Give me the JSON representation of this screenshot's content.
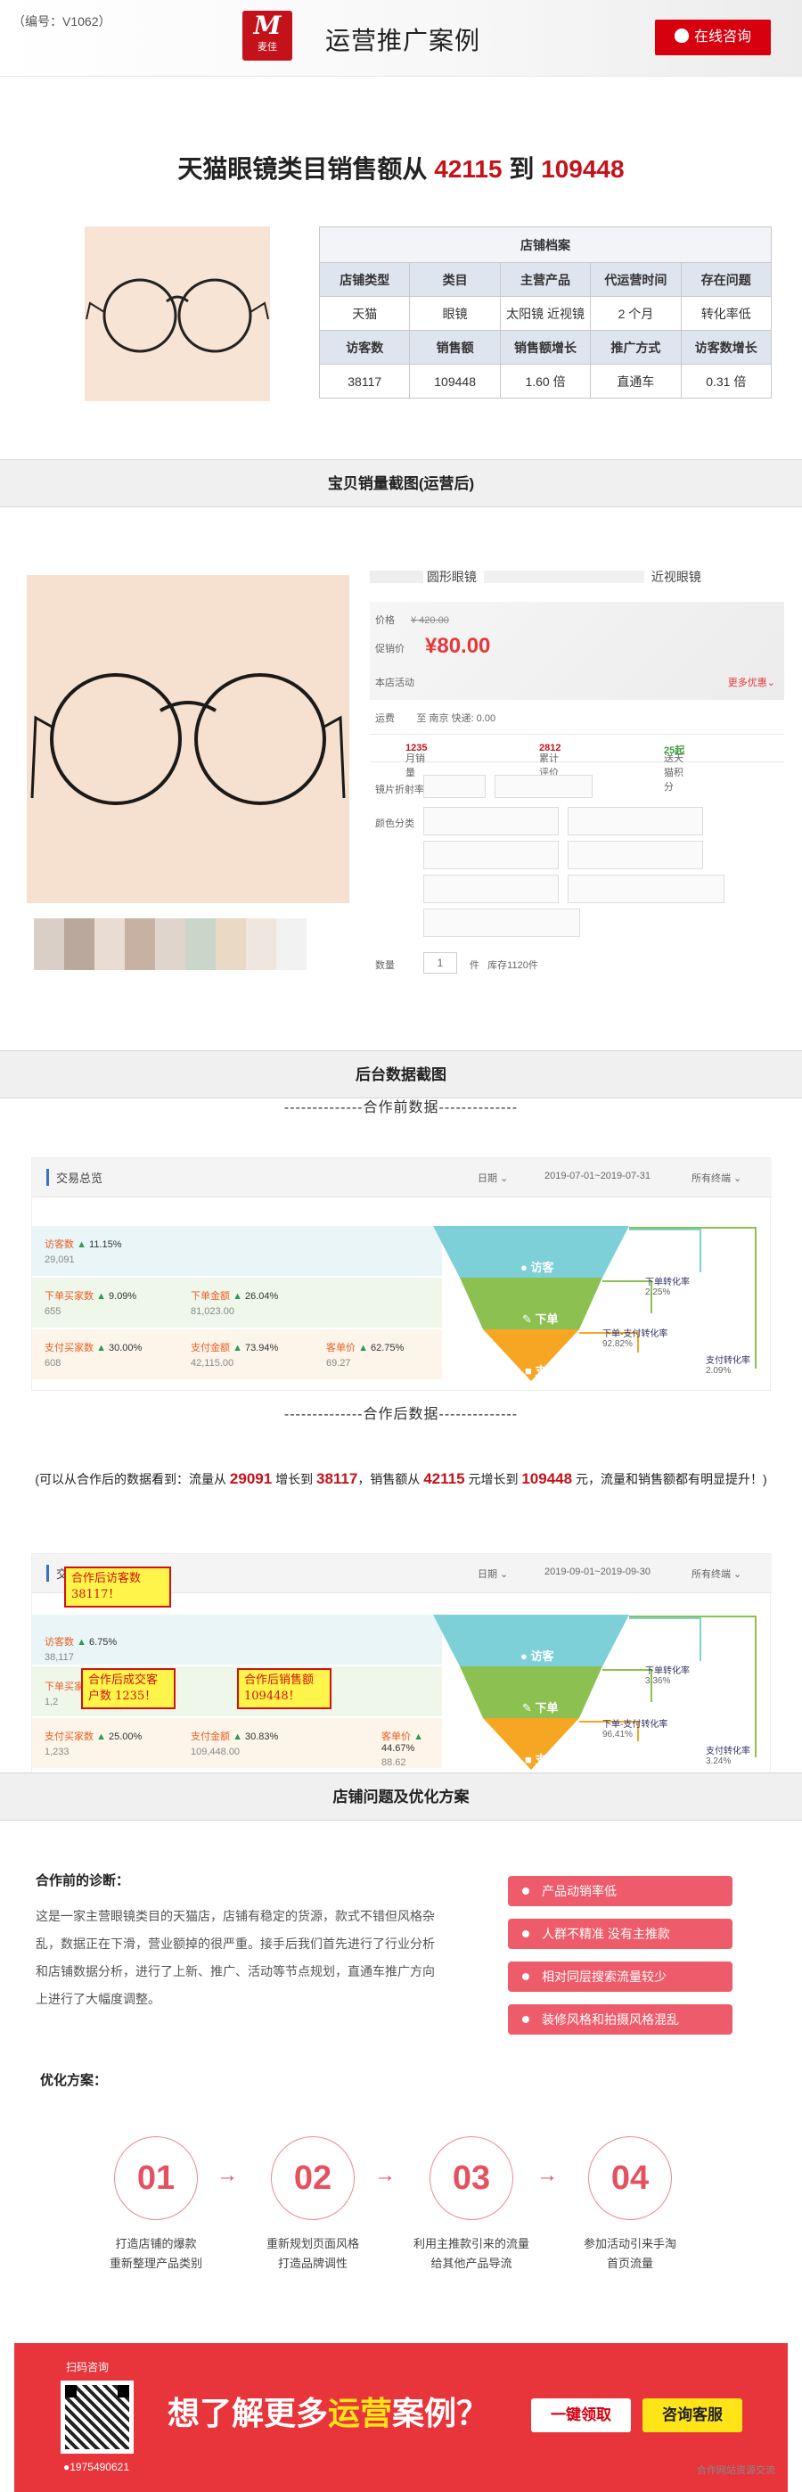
{
  "header": {
    "code": "（编号：V1062）",
    "logo_mark": "M",
    "logo_text": "麦佳",
    "title": "运营推广案例",
    "consult_btn": "在线咨询",
    "brand_color": "#c4121a"
  },
  "headline": {
    "prefix": "天猫眼镜类目销售额从",
    "from": "42115",
    "mid": "到",
    "to": "109448"
  },
  "archive": {
    "title": "店铺档案",
    "row1_headers": [
      "店铺类型",
      "类目",
      "主营产品",
      "代运营时间",
      "存在问题"
    ],
    "row1_values": [
      "天猫",
      "眼镜",
      "太阳镜 近视镜",
      "2 个月",
      "转化率低"
    ],
    "row2_headers": [
      "访客数",
      "销售额",
      "销售额增长",
      "推广方式",
      "访客数增长"
    ],
    "row2_values": [
      "38117",
      "109448",
      "1.60 倍",
      "直通车",
      "0.31 倍"
    ]
  },
  "sections": {
    "sales_shot": "宝贝销量截图(运营后)",
    "backend_shot": "后台数据截图",
    "problems": "店铺问题及优化方案"
  },
  "product": {
    "name_left": "圆形眼镜",
    "name_right": "近视眼镜",
    "price_label": "价格",
    "orig_price": "¥ 420.00",
    "promo_label": "促销价",
    "promo_price": "¥80.00",
    "activity_label": "本店活动",
    "more_offers": "更多优惠",
    "ship_label": "运费",
    "ship_text": "至 南京 快递: 0.00",
    "monthly_label": "月销量",
    "monthly_val": "1235",
    "reviews_label": "累计评价",
    "reviews_val": "2812",
    "points_label": "送天猫积分",
    "points_val": "25起",
    "lens_label": "镜片折射率",
    "color_label": "颜色分类",
    "qty_label": "数量",
    "qty_val": "1",
    "unit": "件",
    "stock": "库存1120件"
  },
  "before": {
    "divider": "--------------合作前数据--------------",
    "title": "交易总览",
    "date_label": "日期",
    "range": "2019-07-01~2019-07-31",
    "terminal": "所有终端",
    "rows": [
      [
        {
          "label": "访客数",
          "chg": "11.15%",
          "val": "29,091"
        }
      ],
      [
        {
          "label": "下单买家数",
          "chg": "9.09%",
          "val": "655"
        },
        {
          "label": "下单金额",
          "chg": "26.04%",
          "val": "81,023.00"
        }
      ],
      [
        {
          "label": "支付买家数",
          "chg": "30.00%",
          "val": "608"
        },
        {
          "label": "支付金额",
          "chg": "73.94%",
          "val": "42,115.00"
        },
        {
          "label": "客单价",
          "chg": "62.75%",
          "val": "69.27"
        }
      ]
    ],
    "funnel": [
      "访客",
      "下单",
      "支付"
    ],
    "side": [
      {
        "label": "下单转化率",
        "val": "2.25%"
      },
      {
        "label": "下单-支付转化率",
        "val": "92.82%"
      },
      {
        "label": "支付转化率",
        "val": "2.09%"
      }
    ]
  },
  "after": {
    "divider": "--------------合作后数据--------------",
    "title": "交易总览",
    "date_label": "日期",
    "range": "2019-09-01~2019-09-30",
    "terminal": "所有终端",
    "rows": [
      [
        {
          "label": "访客数",
          "chg": "6.75%",
          "val": "38,117"
        }
      ],
      [
        {
          "label": "下单买家数",
          "chg": "",
          "val": "1,2"
        }
      ],
      [
        {
          "label": "支付买家数",
          "chg": "25.00%",
          "val": "1,233"
        },
        {
          "label": "支付金额",
          "chg": "30.83%",
          "val": "109,448.00"
        },
        {
          "label": "客单价",
          "chg": "44.67%",
          "val": "88.62"
        }
      ]
    ],
    "funnel": [
      "访客",
      "下单",
      "支付"
    ],
    "side": [
      {
        "label": "下单转化率",
        "val": "3.36%"
      },
      {
        "label": "下单-支付转化率",
        "val": "96.41%"
      },
      {
        "label": "支付转化率",
        "val": "3.24%"
      }
    ],
    "annotations": [
      "合作后访客数 38117！",
      "合作后成交客户数 1235！",
      "合作后销售额 109448！"
    ]
  },
  "summary": {
    "p1": "(可以从合作后的数据看到：流量从",
    "v1": "29091",
    "p2": "增长到",
    "v2": "38117",
    "p3": "，销售额从",
    "v3": "42115",
    "p4": "元增长到",
    "v4": "109448",
    "p5": "元，流量和销售额都有明显提升！)"
  },
  "diagnosis": {
    "title": "合作前的诊断：",
    "body": "这是一家主营眼镜类目的天猫店，店铺有稳定的货源，款式不错但风格杂乱，数据正在下滑，营业额掉的很严重。接手后我们首先进行了行业分析和店铺数据分析，进行了上新、推广、活动等节点规划，直通车推广方向上进行了大幅度调整。",
    "issues": [
      "产品动销率低",
      "人群不精准 没有主推款",
      "相对同层搜索流量较少",
      "装修风格和拍摄风格混乱"
    ]
  },
  "optimize": {
    "title": "优化方案：",
    "steps": [
      {
        "num": "01",
        "l1": "打造店铺的爆款",
        "l2": "重新整理产品类别"
      },
      {
        "num": "02",
        "l1": "重新规划页面风格",
        "l2": "打造品牌调性"
      },
      {
        "num": "03",
        "l1": "利用主推款引来的流量",
        "l2": "给其他产品导流"
      },
      {
        "num": "04",
        "l1": "参加活动引来手淘",
        "l2": "首页流量"
      }
    ],
    "arrow": "→"
  },
  "footer": {
    "scan": "扫码咨询",
    "qq": "1975490621",
    "slogan_a": "想了解更多",
    "slogan_b": "运营",
    "slogan_c": "案例？",
    "btn1": "一键领取",
    "btn2": "咨询客服",
    "accent": "#e8353b"
  },
  "watermark": "合作网站资源交流"
}
